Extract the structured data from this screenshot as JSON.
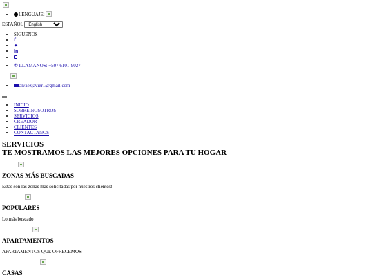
{
  "topbar": {
    "language_label": "LENGUAJE:",
    "current_language": "ESPAÑOL",
    "language_options": [
      "English"
    ],
    "social_label": "SIGUENOS",
    "phone_link": "LLAMANOS: +507 6101-9027",
    "email_link": "alvaezjavier1@gmail.com"
  },
  "nav": {
    "items": [
      "INICIO",
      "SOBRE NOSOTROS",
      "SERVICIOS",
      "CREADOR",
      "CLIENTES",
      "CONTACTANOS"
    ]
  },
  "hero": {
    "line1": "SERVICIOS",
    "line2": "TE MOSTRAMOS LAS MEJORES OPCIONES PARA TU HOGAR"
  },
  "services": [
    {
      "title": "ZONAS MÁS BUSCADAS",
      "text": "Estas son las zonas más solicitadas por nuestros clientes!"
    },
    {
      "title": "POPULARES",
      "text": "Lo más buscado"
    },
    {
      "title": "APARTAMENTOS",
      "text": "APARTAMENTOS QUE OFRECEMOS"
    },
    {
      "title": "CASAS",
      "text": ""
    }
  ],
  "icons": {
    "language": "globe-icon",
    "facebook": "facebook-icon",
    "twitter": "twitter-icon",
    "linkedin": "linkedin-icon",
    "instagram": "instagram-icon",
    "phone": "phone-icon",
    "email": "envelope-icon"
  },
  "colors": {
    "link": "#1a0dab",
    "text": "#000000",
    "background": "#ffffff"
  }
}
